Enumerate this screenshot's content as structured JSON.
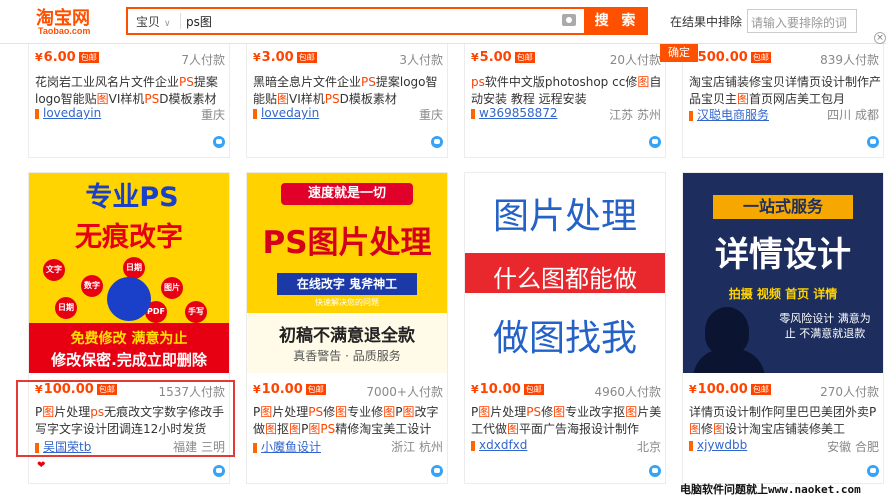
{
  "header": {
    "logo_text": "淘宝网",
    "logo_sub": "Taobao.com",
    "search_type": "宝贝",
    "search_query": "ps图",
    "search_button": "搜 索",
    "exclude_label": "在结果中排除",
    "exclude_placeholder": "请输入要排除的词",
    "confirm_button": "确定",
    "close_symbol": "×"
  },
  "top_items": [
    {
      "price": "6.00",
      "baoyou": "包邮",
      "sold": "7人付款",
      "title": "花岗岩工业风名片文件企业PS提案logo智能贴图VI样机PSD模板素材",
      "shop": "lovedayin",
      "location": "重庆"
    },
    {
      "price": "3.00",
      "baoyou": "包邮",
      "sold": "3人付款",
      "title": "黑暗全息片文件企业PS提案logo智能贴图VI样机PSD模板素材",
      "shop": "lovedayin",
      "location": "重庆"
    },
    {
      "price": "5.00",
      "baoyou": "包邮",
      "sold": "20人付款",
      "title": "ps软件中文版photoshop cc修图自动安装 教程 远程安装",
      "shop": "w369858872",
      "location": "江苏 苏州"
    },
    {
      "price": "500.00",
      "baoyou": "包邮",
      "sold": "839人付款",
      "title": "淘宝店铺装修宝贝详情页设计制作产品宝贝主图首页网店美工包月",
      "shop": "汉聪电商服务",
      "location": "四川 成都"
    }
  ],
  "bottom_items": [
    {
      "price": "100.00",
      "baoyou": "包邮",
      "sold": "1537人付款",
      "title": "P图片处理ps无痕改文字数字修改手写字文字设计团调连12小时发货",
      "shop": "吴国荣tb",
      "location": "福建 三明",
      "image": {
        "line1": "专业PS",
        "line2": "无痕改字",
        "bubbles": [
          "文字",
          "数字",
          "日期",
          "图片",
          "PDF",
          "日期件",
          "手写字"
        ],
        "bottom1": "免费修改 满意为止",
        "bottom2": "修改保密.完成立即删除"
      }
    },
    {
      "price": "10.00",
      "baoyou": "包邮",
      "sold": "7000+人付款",
      "title": "P图片处理PS修图专业修图P图改字做图抠图P图PS精修淘宝美工设计",
      "shop": "小魔鱼设计",
      "location": "浙江 杭州",
      "image": {
        "banner": "速度就是一切",
        "big": "PS图片处理",
        "sub": "在线改字 鬼斧神工",
        "sub2": "快速解决您的问题",
        "bottom1": "初稿不满意退全款",
        "bottom2": "真香警告 · 品质服务"
      }
    },
    {
      "price": "10.00",
      "baoyou": "包邮",
      "sold": "4960人付款",
      "title": "P图片处理PS修图专业改字抠图片美工代做图平面广告海报设计制作",
      "shop": "xdxdfxd",
      "location": "北京",
      "image": {
        "line1": "图片处理",
        "line2": "什么图都能做",
        "line3": "做图找我"
      }
    },
    {
      "price": "100.00",
      "baoyou": "包邮",
      "sold": "270人付款",
      "title": "详情页设计制作阿里巴巴美团外卖P图修图设计淘宝店铺装修美工",
      "shop": "xjywdbb",
      "location": "安徽 合肥",
      "image": {
        "ribbon": "一站式服务",
        "big": "详情设计",
        "tags": "拍摄 视频 首页 详情",
        "quote": "零风险设计 满意为止 不满意就退款"
      }
    }
  ],
  "currency": "¥",
  "watermark": "电脑软件问题就上www.naoket.com",
  "colors": {
    "accent": "#ff5000",
    "price": "#ff4400",
    "shop_link": "#3366cc",
    "highlight": "#e53935"
  }
}
